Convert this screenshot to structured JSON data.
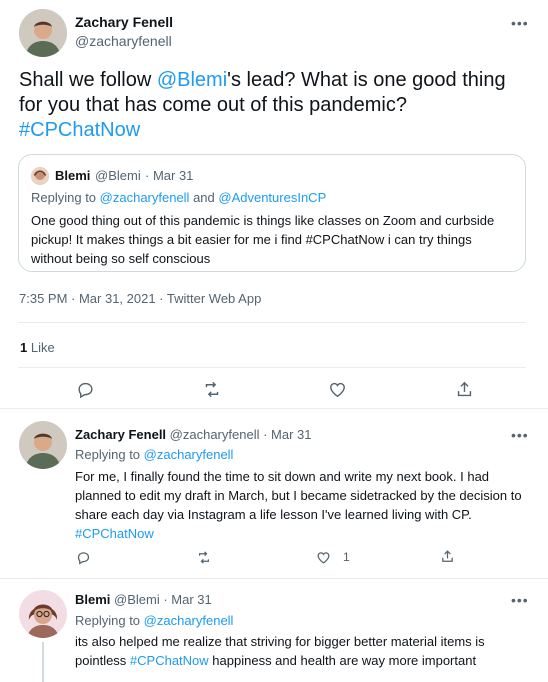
{
  "main_tweet": {
    "author_name": "Zachary Fenell",
    "author_handle": "@zacharyfenell",
    "text_pre": "Shall we follow ",
    "text_mention": "@Blemi",
    "text_post": "'s lead? What is one good thing for you that has come out of this pandemic?",
    "text_hashtag": "#CPChatNow",
    "more_label": "•••",
    "timestamp": "7:35 PM · Mar 31, 2021 · Twitter Web App",
    "like_count": "1",
    "like_label": "Like",
    "quote": {
      "author_name": "Blemi",
      "author_handle": "@Blemi",
      "date": "· Mar 31",
      "replying_prefix": "Replying to ",
      "replying_to_1": "@zacharyfenell",
      "replying_and": " and ",
      "replying_to_2": "@AdventuresInCP",
      "text": "One good thing out of this pandemic is things like classes on Zoom and curbside pickup! It makes things a bit easier for me i find #CPChatNow i can try things without being so self conscious"
    }
  },
  "replies": [
    {
      "author_name": "Zachary Fenell",
      "author_handle": "@zacharyfenell",
      "date": "· Mar 31",
      "replying_prefix": "Replying to ",
      "replying_to": "@zacharyfenell",
      "text": "For me, I finally found the time to sit down and write my next book. I had planned to edit my draft in March, but I became sidetracked by the decision to share each day via Instagram a life lesson I've learned living with CP.",
      "hashtag": "#CPChatNow",
      "like_count": "1",
      "more_label": "•••"
    },
    {
      "author_name": "Blemi",
      "author_handle": "@Blemi",
      "date": "· Mar 31",
      "replying_prefix": "Replying to ",
      "replying_to": "@zacharyfenell",
      "text_pre": "its also helped me realize that striving for bigger better material items is pointless ",
      "hashtag": "#CPChatNow",
      "text_post": " happiness and health are way more important",
      "more_label": "•••"
    }
  ],
  "icons": [
    "reply-icon",
    "retweet-icon",
    "like-icon",
    "share-icon",
    "more-icon"
  ],
  "colors": {
    "link": "#1d9bf0",
    "muted": "#536471",
    "text": "#0f1419",
    "divider": "#e6ecf0"
  }
}
